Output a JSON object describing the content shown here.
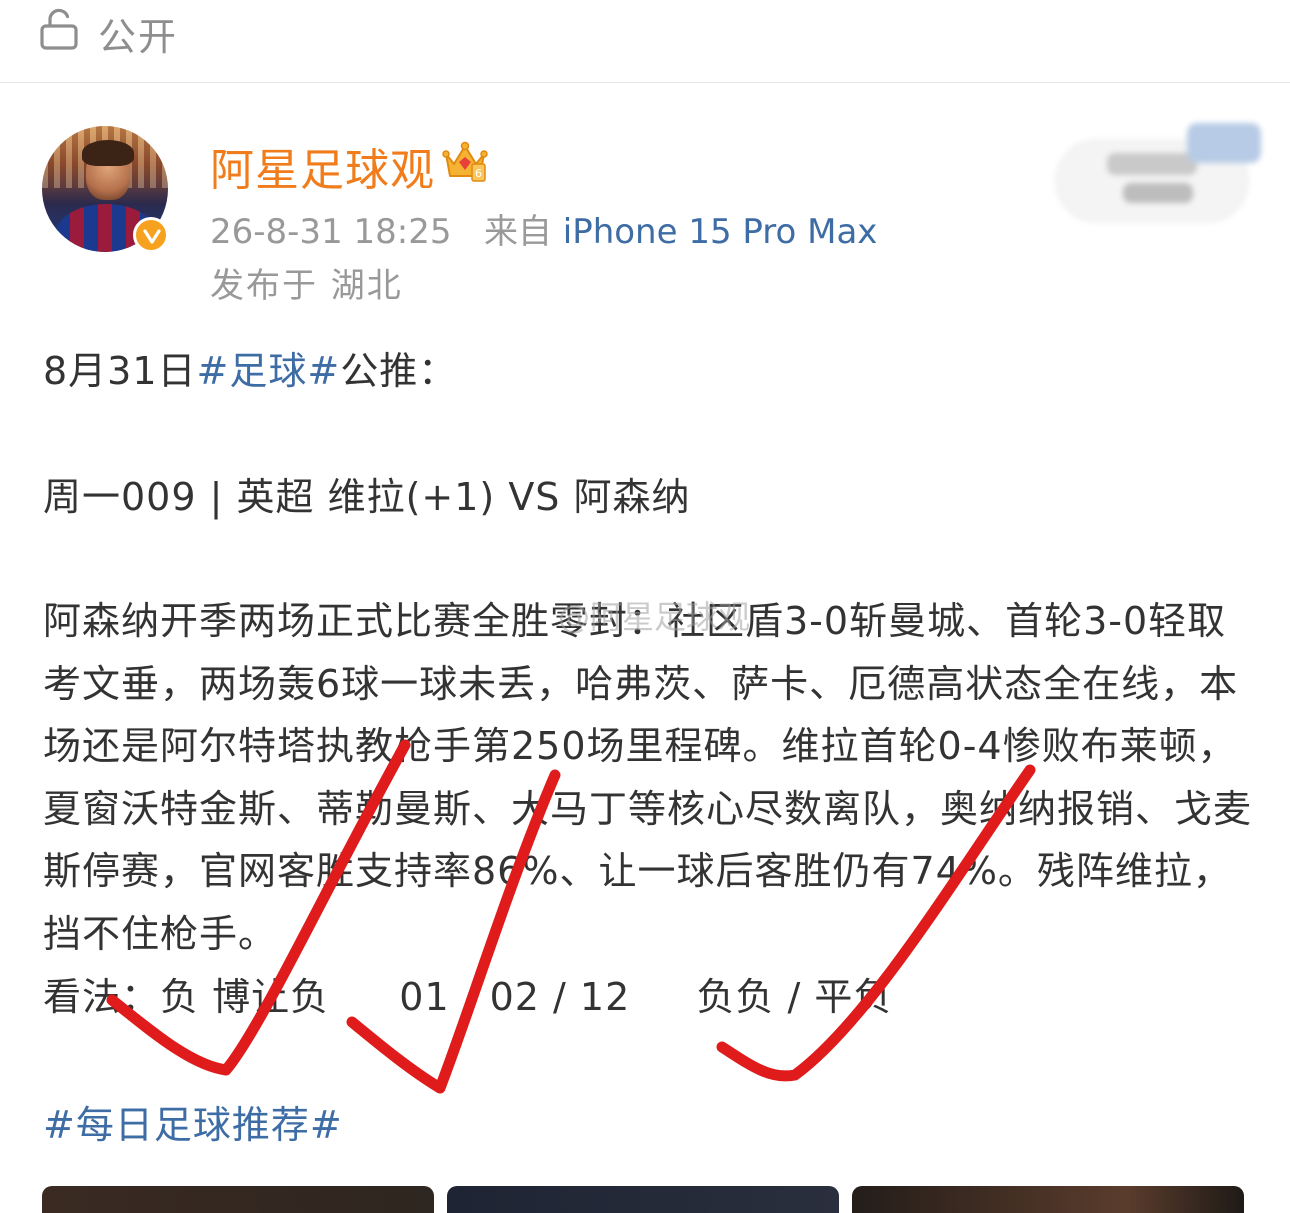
{
  "topbar": {
    "visibility_label": "公开"
  },
  "author": {
    "name": "阿星足球观",
    "timestamp": "26-8-31 18:25",
    "source_prefix": "来自",
    "source_device": "iPhone 15 Pro Max",
    "location": "发布于 湖北"
  },
  "post": {
    "line1_date": "8月31日",
    "line1_tag": "#足球#",
    "line1_suffix": "公推：",
    "match_line": "周一009 | 英超 维拉(+1) VS 阿森纳",
    "analysis": "阿森纳开季两场正式比赛全胜零封：社区盾3-0斩曼城、首轮3-0轻取考文垂，两场轰6球一球未丢，哈弗茨、萨卡、厄德高状态全在线，本场还是阿尔特塔执教枪手第250场里程碑。维拉首轮0-4惨败布莱顿，夏窗沃特金斯、蒂勒曼斯、大马丁等核心尽数离队，奥纳纳报销、戈麦斯停赛，官网客胜支持率86%、让一球后客胜仍有74%。残阵维拉，挡不住枪手。",
    "view_label": "看法：负 博让负",
    "view_scores": "01 / 02 / 12",
    "view_halffull": "负负 / 平负",
    "bottom_tag": "#每日足球推荐#",
    "watermark": "@阿星足球观"
  },
  "colors": {
    "author_name": "#f07c1b",
    "link_blue": "#3e6ca5",
    "meta_gray": "#999999",
    "check_red": "#e01b1b"
  },
  "icons": [
    "lock-icon",
    "crown-icon",
    "verify-badge-icon",
    "checkmark-icon"
  ]
}
